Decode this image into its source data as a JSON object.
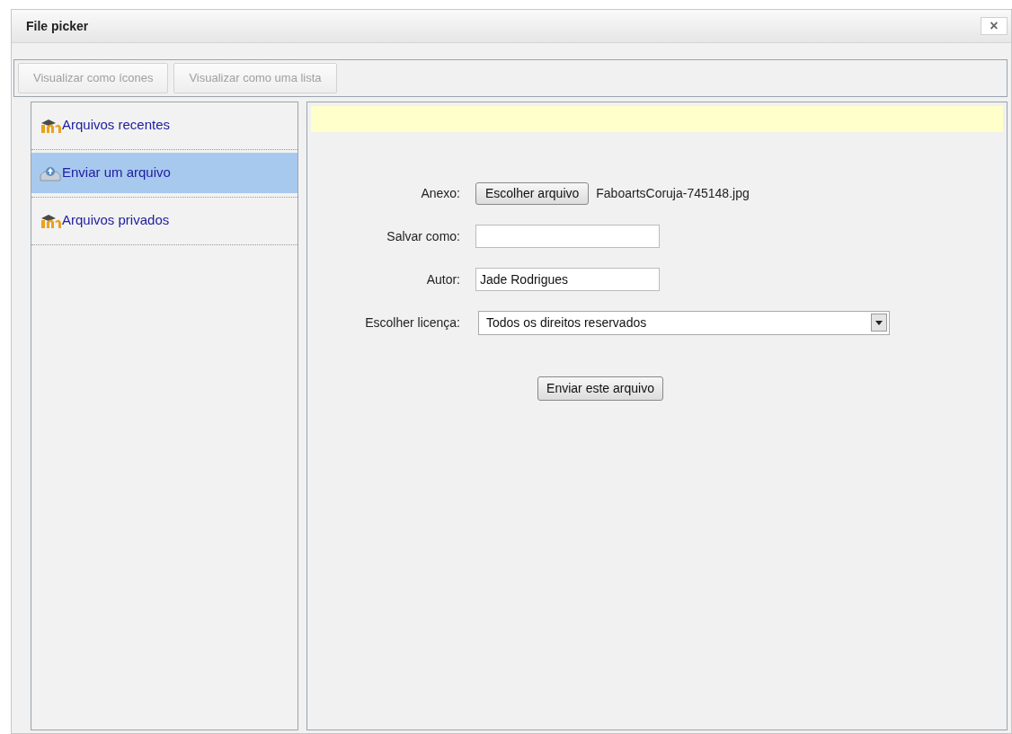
{
  "window": {
    "title": "File picker",
    "close": "×"
  },
  "view_buttons": [
    {
      "label": "Visualizar como ícones",
      "disabled": true
    },
    {
      "label": "Visualizar como uma lista",
      "disabled": true
    }
  ],
  "sidebar": {
    "items": [
      {
        "label": "Arquivos recentes",
        "kind": "repository",
        "selected": false
      },
      {
        "label": "Enviar um arquivo",
        "kind": "upload",
        "selected": true
      },
      {
        "label": "Arquivos privados",
        "kind": "repository",
        "selected": false
      }
    ]
  },
  "form": {
    "fields": [
      {
        "kind": "file",
        "label": "Anexo:",
        "button": "Escolher arquivo",
        "value": "FaboartsCoruja-745148.jpg"
      },
      {
        "kind": "text",
        "label": "Salvar como:"
      },
      {
        "kind": "text",
        "label": "Autor:",
        "value": "Jade Rodrigues"
      },
      {
        "kind": "select",
        "label": "Escolher licença:",
        "value": "Todos os direitos reservados"
      }
    ],
    "submit": "Enviar este arquivo"
  }
}
